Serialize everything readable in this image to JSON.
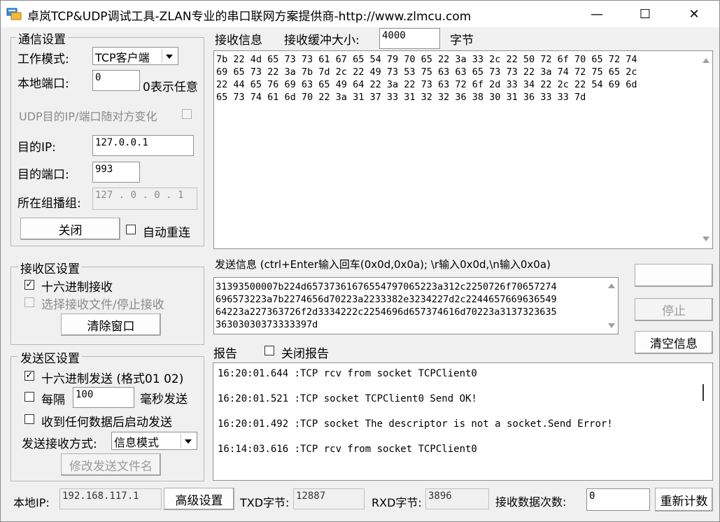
{
  "window": {
    "title": "卓岚TCP&UDP调试工具-ZLAN专业的串口联网方案提供商-http://www.zlmcu.com",
    "minimize": "—",
    "maximize": "☐",
    "close": "✕"
  },
  "comm": {
    "group_title": "通信设置",
    "mode_label": "工作模式:",
    "mode_value": "TCP客户端",
    "local_port_label": "本地端口:",
    "local_port_value": "0",
    "local_port_hint": "0表示任意",
    "udp_follow_label": "UDP目的IP/端口随对方变化",
    "dest_ip_label": "目的IP:",
    "dest_ip_value": "127.0.0.1",
    "dest_port_label": "目的端口:",
    "dest_port_value": "993",
    "multicast_label": "所在组播组:",
    "multicast_value": "127 . 0  . 0  . 1",
    "close_button": "关闭",
    "auto_reconnect_label": "自动重连"
  },
  "recv_settings": {
    "group_title": "接收区设置",
    "hex_recv_label": "十六进制接收",
    "hex_recv_checked": "✓",
    "select_file_label": "选择接收文件/停止接收",
    "clear_button": "清除窗口"
  },
  "send_settings": {
    "group_title": "发送区设置",
    "hex_send_label": "十六进制发送 (格式01 02)",
    "hex_send_checked": "✓",
    "every_label": "每隔",
    "interval_value": "100",
    "interval_unit": "毫秒发送",
    "auto_send_label": "收到任何数据后启动发送",
    "mode_label": "发送接收方式:",
    "mode_value": "信息模式",
    "modify_file_button": "修改发送文件名"
  },
  "recv_info": {
    "label": "接收信息",
    "buffer_label": "接收缓冲大小:",
    "buffer_value": "4000",
    "buffer_unit": "字节",
    "lines": [
      "7b 22 4d 65 73 73 61 67 65 54 79 70 65 22 3a 33 2c 22 50 72 6f 70 65 72 74",
      "69 65 73 22 3a 7b 7d 2c 22 49 73 53 75 63 63 65 73 73 22 3a 74 72 75 65 2c",
      "22 44 65 76 69 63 65 49 64 22 3a 22 73 63 72 6f 2d 33 34 22 2c 22 54 69 6d",
      "65 73 74 61 6d 70 22 3a 31 37 33 31 32 32 36 38 30 31 36 33 33 7d"
    ]
  },
  "send_info": {
    "label": "发送信息 (ctrl+Enter输入回车(0x0d,0x0a); \\r输入0x0d,\\n输入0x0a)",
    "lines": [
      "31393500007b224d65737361676554797065223a312c2250726f70657274",
      "696573223a7b2274656d70223a2233382e3234227d2c2244657669636549",
      "64223a227363726f2d3334222c2254696d657374616d70223a3137323635",
      "36303030373333397d"
    ],
    "send_button": "",
    "stop_button": "停止",
    "clear_button": "清空信息"
  },
  "report": {
    "label": "报告",
    "close_report_label": "关闭报告",
    "lines": [
      "16:20:01.644 :TCP rcv from socket TCPClient0",
      "16:20:01.521 :TCP socket TCPClient0  Send OK!",
      "16:20:01.492 :TCP socket  The descriptor is not a socket.Send Error!",
      "16:14:03.616 :TCP rcv from socket TCPClient0"
    ]
  },
  "status": {
    "local_ip_label": "本地IP:",
    "local_ip_value": "192.168.117.1",
    "advanced_button": "高级设置",
    "txd_label": "TXD字节:",
    "txd_value": "12887",
    "rxd_label": "RXD字节:",
    "rxd_value": "3896",
    "recv_count_label": "接收数据次数:",
    "recv_count_value": "0",
    "recount_button": "重新计数"
  }
}
